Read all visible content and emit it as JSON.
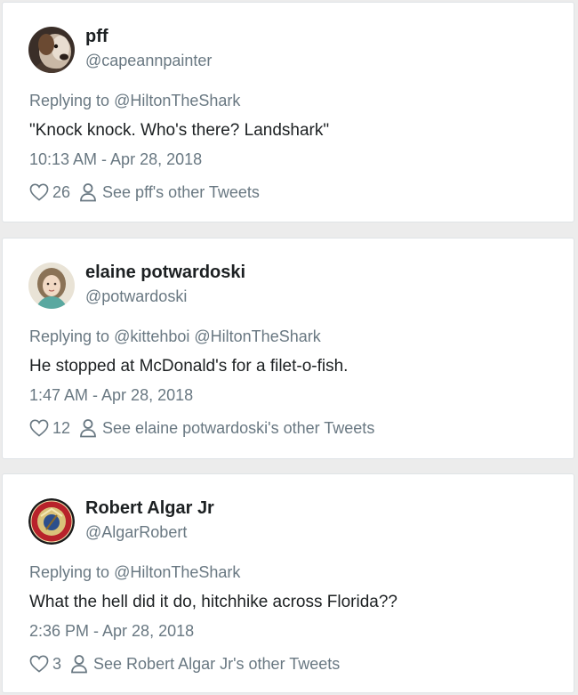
{
  "tweets": [
    {
      "name": "pff",
      "handle": "@capeannpainter",
      "replying_prefix": "Replying to",
      "mentions": "@HiltonTheShark",
      "text": "\"Knock knock. Who's there? Landshark\"",
      "timestamp": "10:13 AM - Apr 28, 2018",
      "likes": "26",
      "other_tweets_label": "See pff's other Tweets",
      "avatar_icon": "dog-avatar-icon"
    },
    {
      "name": "elaine potwardoski",
      "handle": "@potwardoski",
      "replying_prefix": "Replying to",
      "mentions": "@kittehboi @HiltonTheShark",
      "text": "He stopped at McDonald's for a filet-o-fish.",
      "timestamp": "1:47 AM - Apr 28, 2018",
      "likes": "12",
      "other_tweets_label": "See elaine potwardoski's other Tweets",
      "avatar_icon": "woman-portrait-avatar-icon"
    },
    {
      "name": "Robert Algar Jr",
      "handle": "@AlgarRobert",
      "replying_prefix": "Replying to",
      "mentions": "@HiltonTheShark",
      "text": "What the hell did it do, hitchhike across Florida??",
      "timestamp": "2:36 PM - Apr 28, 2018",
      "likes": "3",
      "other_tweets_label": "See Robert Algar Jr's other Tweets",
      "avatar_icon": "marine-corps-emblem-avatar-icon"
    }
  ],
  "colors": {
    "text_primary": "#1c2022",
    "text_secondary": "#697882",
    "card_background": "#ffffff",
    "card_border": "#dfe3e6",
    "page_background": "#ececec"
  }
}
